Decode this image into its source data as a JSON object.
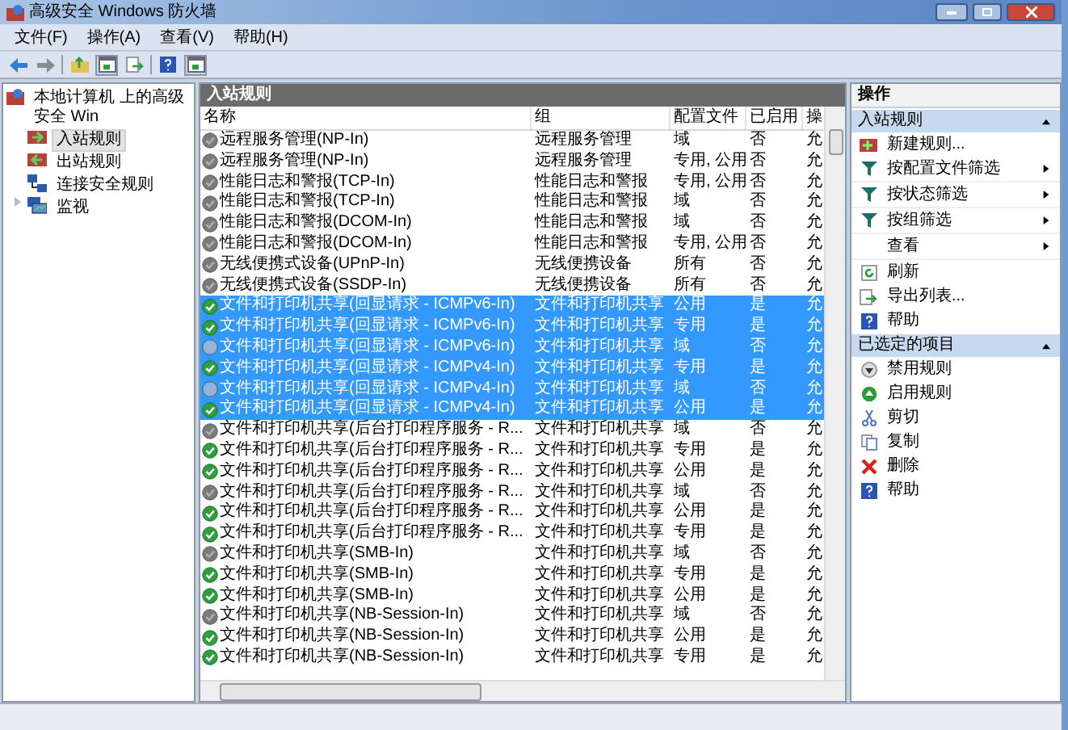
{
  "window": {
    "title": "高级安全 Windows 防火墙"
  },
  "menu": [
    "文件(F)",
    "操作(A)",
    "查看(V)",
    "帮助(H)"
  ],
  "tree": {
    "label": "本地计算机 上的高级安全 Win",
    "children": [
      {
        "label": "入站规则",
        "selected": true
      },
      {
        "label": "出站规则",
        "selected": false
      },
      {
        "label": "连接安全规则",
        "selected": false
      },
      {
        "label": "监视",
        "selected": false,
        "expanded": false
      }
    ]
  },
  "main": {
    "title": "入站规则",
    "columns": [
      "名称",
      "组",
      "配置文件",
      "已启用",
      "操"
    ],
    "rows": [
      {
        "name": "远程服务管理(NP-In)",
        "group": "远程服务管理",
        "profile": "域",
        "enabled_text": "否",
        "action": "允",
        "enabled": false,
        "selected": false
      },
      {
        "name": "远程服务管理(NP-In)",
        "group": "远程服务管理",
        "profile": "专用, 公用",
        "enabled_text": "否",
        "action": "允",
        "enabled": false,
        "selected": false
      },
      {
        "name": "性能日志和警报(TCP-In)",
        "group": "性能日志和警报",
        "profile": "专用, 公用",
        "enabled_text": "否",
        "action": "允",
        "enabled": false,
        "selected": false
      },
      {
        "name": "性能日志和警报(TCP-In)",
        "group": "性能日志和警报",
        "profile": "域",
        "enabled_text": "否",
        "action": "允",
        "enabled": false,
        "selected": false
      },
      {
        "name": "性能日志和警报(DCOM-In)",
        "group": "性能日志和警报",
        "profile": "域",
        "enabled_text": "否",
        "action": "允",
        "enabled": false,
        "selected": false
      },
      {
        "name": "性能日志和警报(DCOM-In)",
        "group": "性能日志和警报",
        "profile": "专用, 公用",
        "enabled_text": "否",
        "action": "允",
        "enabled": false,
        "selected": false
      },
      {
        "name": "无线便携式设备(UPnP-In)",
        "group": "无线便携设备",
        "profile": "所有",
        "enabled_text": "否",
        "action": "允",
        "enabled": false,
        "selected": false
      },
      {
        "name": "无线便携式设备(SSDP-In)",
        "group": "无线便携设备",
        "profile": "所有",
        "enabled_text": "否",
        "action": "允",
        "enabled": false,
        "selected": false
      },
      {
        "name": "文件和打印机共享(回显请求 - ICMPv6-In)",
        "group": "文件和打印机共享",
        "profile": "公用",
        "enabled_text": "是",
        "action": "允",
        "enabled": true,
        "selected": true
      },
      {
        "name": "文件和打印机共享(回显请求 - ICMPv6-In)",
        "group": "文件和打印机共享",
        "profile": "专用",
        "enabled_text": "是",
        "action": "允",
        "enabled": true,
        "selected": true
      },
      {
        "name": "文件和打印机共享(回显请求 - ICMPv6-In)",
        "group": "文件和打印机共享",
        "profile": "域",
        "enabled_text": "否",
        "action": "允",
        "enabled": false,
        "selected": true
      },
      {
        "name": "文件和打印机共享(回显请求 - ICMPv4-In)",
        "group": "文件和打印机共享",
        "profile": "专用",
        "enabled_text": "是",
        "action": "允",
        "enabled": true,
        "selected": true
      },
      {
        "name": "文件和打印机共享(回显请求 - ICMPv4-In)",
        "group": "文件和打印机共享",
        "profile": "域",
        "enabled_text": "否",
        "action": "允",
        "enabled": false,
        "selected": true
      },
      {
        "name": "文件和打印机共享(回显请求 - ICMPv4-In)",
        "group": "文件和打印机共享",
        "profile": "公用",
        "enabled_text": "是",
        "action": "允",
        "enabled": true,
        "selected": true
      },
      {
        "name": "文件和打印机共享(后台打印程序服务 - R...",
        "group": "文件和打印机共享",
        "profile": "域",
        "enabled_text": "否",
        "action": "允",
        "enabled": false,
        "selected": false
      },
      {
        "name": "文件和打印机共享(后台打印程序服务 - R...",
        "group": "文件和打印机共享",
        "profile": "专用",
        "enabled_text": "是",
        "action": "允",
        "enabled": true,
        "selected": false
      },
      {
        "name": "文件和打印机共享(后台打印程序服务 - R...",
        "group": "文件和打印机共享",
        "profile": "公用",
        "enabled_text": "是",
        "action": "允",
        "enabled": true,
        "selected": false
      },
      {
        "name": "文件和打印机共享(后台打印程序服务 - R...",
        "group": "文件和打印机共享",
        "profile": "域",
        "enabled_text": "否",
        "action": "允",
        "enabled": false,
        "selected": false
      },
      {
        "name": "文件和打印机共享(后台打印程序服务 - R...",
        "group": "文件和打印机共享",
        "profile": "公用",
        "enabled_text": "是",
        "action": "允",
        "enabled": true,
        "selected": false
      },
      {
        "name": "文件和打印机共享(后台打印程序服务 - R...",
        "group": "文件和打印机共享",
        "profile": "专用",
        "enabled_text": "是",
        "action": "允",
        "enabled": true,
        "selected": false
      },
      {
        "name": "文件和打印机共享(SMB-In)",
        "group": "文件和打印机共享",
        "profile": "域",
        "enabled_text": "否",
        "action": "允",
        "enabled": false,
        "selected": false
      },
      {
        "name": "文件和打印机共享(SMB-In)",
        "group": "文件和打印机共享",
        "profile": "专用",
        "enabled_text": "是",
        "action": "允",
        "enabled": true,
        "selected": false
      },
      {
        "name": "文件和打印机共享(SMB-In)",
        "group": "文件和打印机共享",
        "profile": "公用",
        "enabled_text": "是",
        "action": "允",
        "enabled": true,
        "selected": false
      },
      {
        "name": "文件和打印机共享(NB-Session-In)",
        "group": "文件和打印机共享",
        "profile": "域",
        "enabled_text": "否",
        "action": "允",
        "enabled": false,
        "selected": false
      },
      {
        "name": "文件和打印机共享(NB-Session-In)",
        "group": "文件和打印机共享",
        "profile": "公用",
        "enabled_text": "是",
        "action": "允",
        "enabled": true,
        "selected": false
      },
      {
        "name": "文件和打印机共享(NB-Session-In)",
        "group": "文件和打印机共享",
        "profile": "专用",
        "enabled_text": "是",
        "action": "允",
        "enabled": true,
        "selected": false
      }
    ]
  },
  "actions": {
    "title": "操作",
    "sections": [
      {
        "title": "入站规则",
        "expanded": true,
        "items": [
          {
            "label": "新建规则...",
            "submenu": false
          },
          {
            "label": "按配置文件筛选",
            "submenu": true
          },
          {
            "label": "按状态筛选",
            "submenu": true
          },
          {
            "label": "按组筛选",
            "submenu": true
          },
          {
            "label": "查看",
            "submenu": true
          },
          {
            "label": "刷新",
            "submenu": false
          },
          {
            "label": "导出列表...",
            "submenu": false
          },
          {
            "label": "帮助",
            "submenu": false
          }
        ]
      },
      {
        "title": "已选定的项目",
        "expanded": true,
        "items": [
          {
            "label": "禁用规则",
            "submenu": false
          },
          {
            "label": "启用规则",
            "submenu": false
          },
          {
            "label": "剪切",
            "submenu": false
          },
          {
            "label": "复制",
            "submenu": false
          },
          {
            "label": "删除",
            "submenu": false
          },
          {
            "label": "帮助",
            "submenu": false
          }
        ]
      }
    ]
  }
}
